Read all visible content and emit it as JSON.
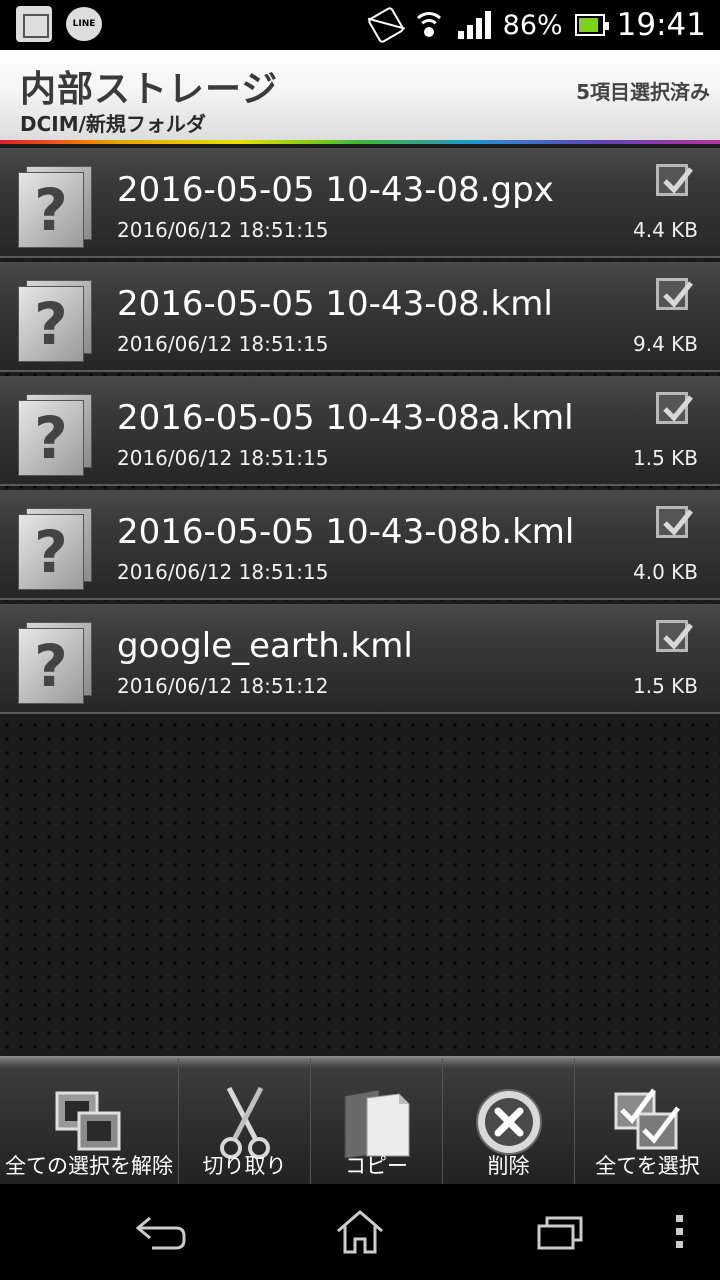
{
  "status_bar": {
    "line_label": "LINE",
    "battery_percent": "86%",
    "battery_level": 0.86,
    "time": "19:41",
    "icons": [
      "app-icon",
      "line-icon",
      "vibrate-icon",
      "wifi-icon",
      "signal-icon",
      "battery-icon"
    ]
  },
  "header": {
    "title": "内部ストレージ",
    "path": "DCIM/新規フォルダ",
    "selection_count": "5項目選択済み"
  },
  "files": [
    {
      "name": "2016-05-05 10-43-08.gpx",
      "date": "2016/06/12 18:51:15",
      "size": "4.4 KB",
      "checked": true
    },
    {
      "name": "2016-05-05 10-43-08.kml",
      "date": "2016/06/12 18:51:15",
      "size": "9.4 KB",
      "checked": true
    },
    {
      "name": "2016-05-05 10-43-08a.kml",
      "date": "2016/06/12 18:51:15",
      "size": "1.5 KB",
      "checked": true
    },
    {
      "name": "2016-05-05 10-43-08b.kml",
      "date": "2016/06/12 18:51:15",
      "size": "4.0 KB",
      "checked": true
    },
    {
      "name": "google_earth.kml",
      "date": "2016/06/12 18:51:12",
      "size": "1.5 KB",
      "checked": true
    }
  ],
  "toolbar": {
    "deselect_all": "全ての選択を解除",
    "cut": "切り取り",
    "copy": "コピー",
    "delete": "削除",
    "select_all": "全てを選択"
  },
  "colors": {
    "accent_battery": "#7bd414",
    "header_bg": "#f4f4f4",
    "list_bg": "#1b1b1b"
  }
}
